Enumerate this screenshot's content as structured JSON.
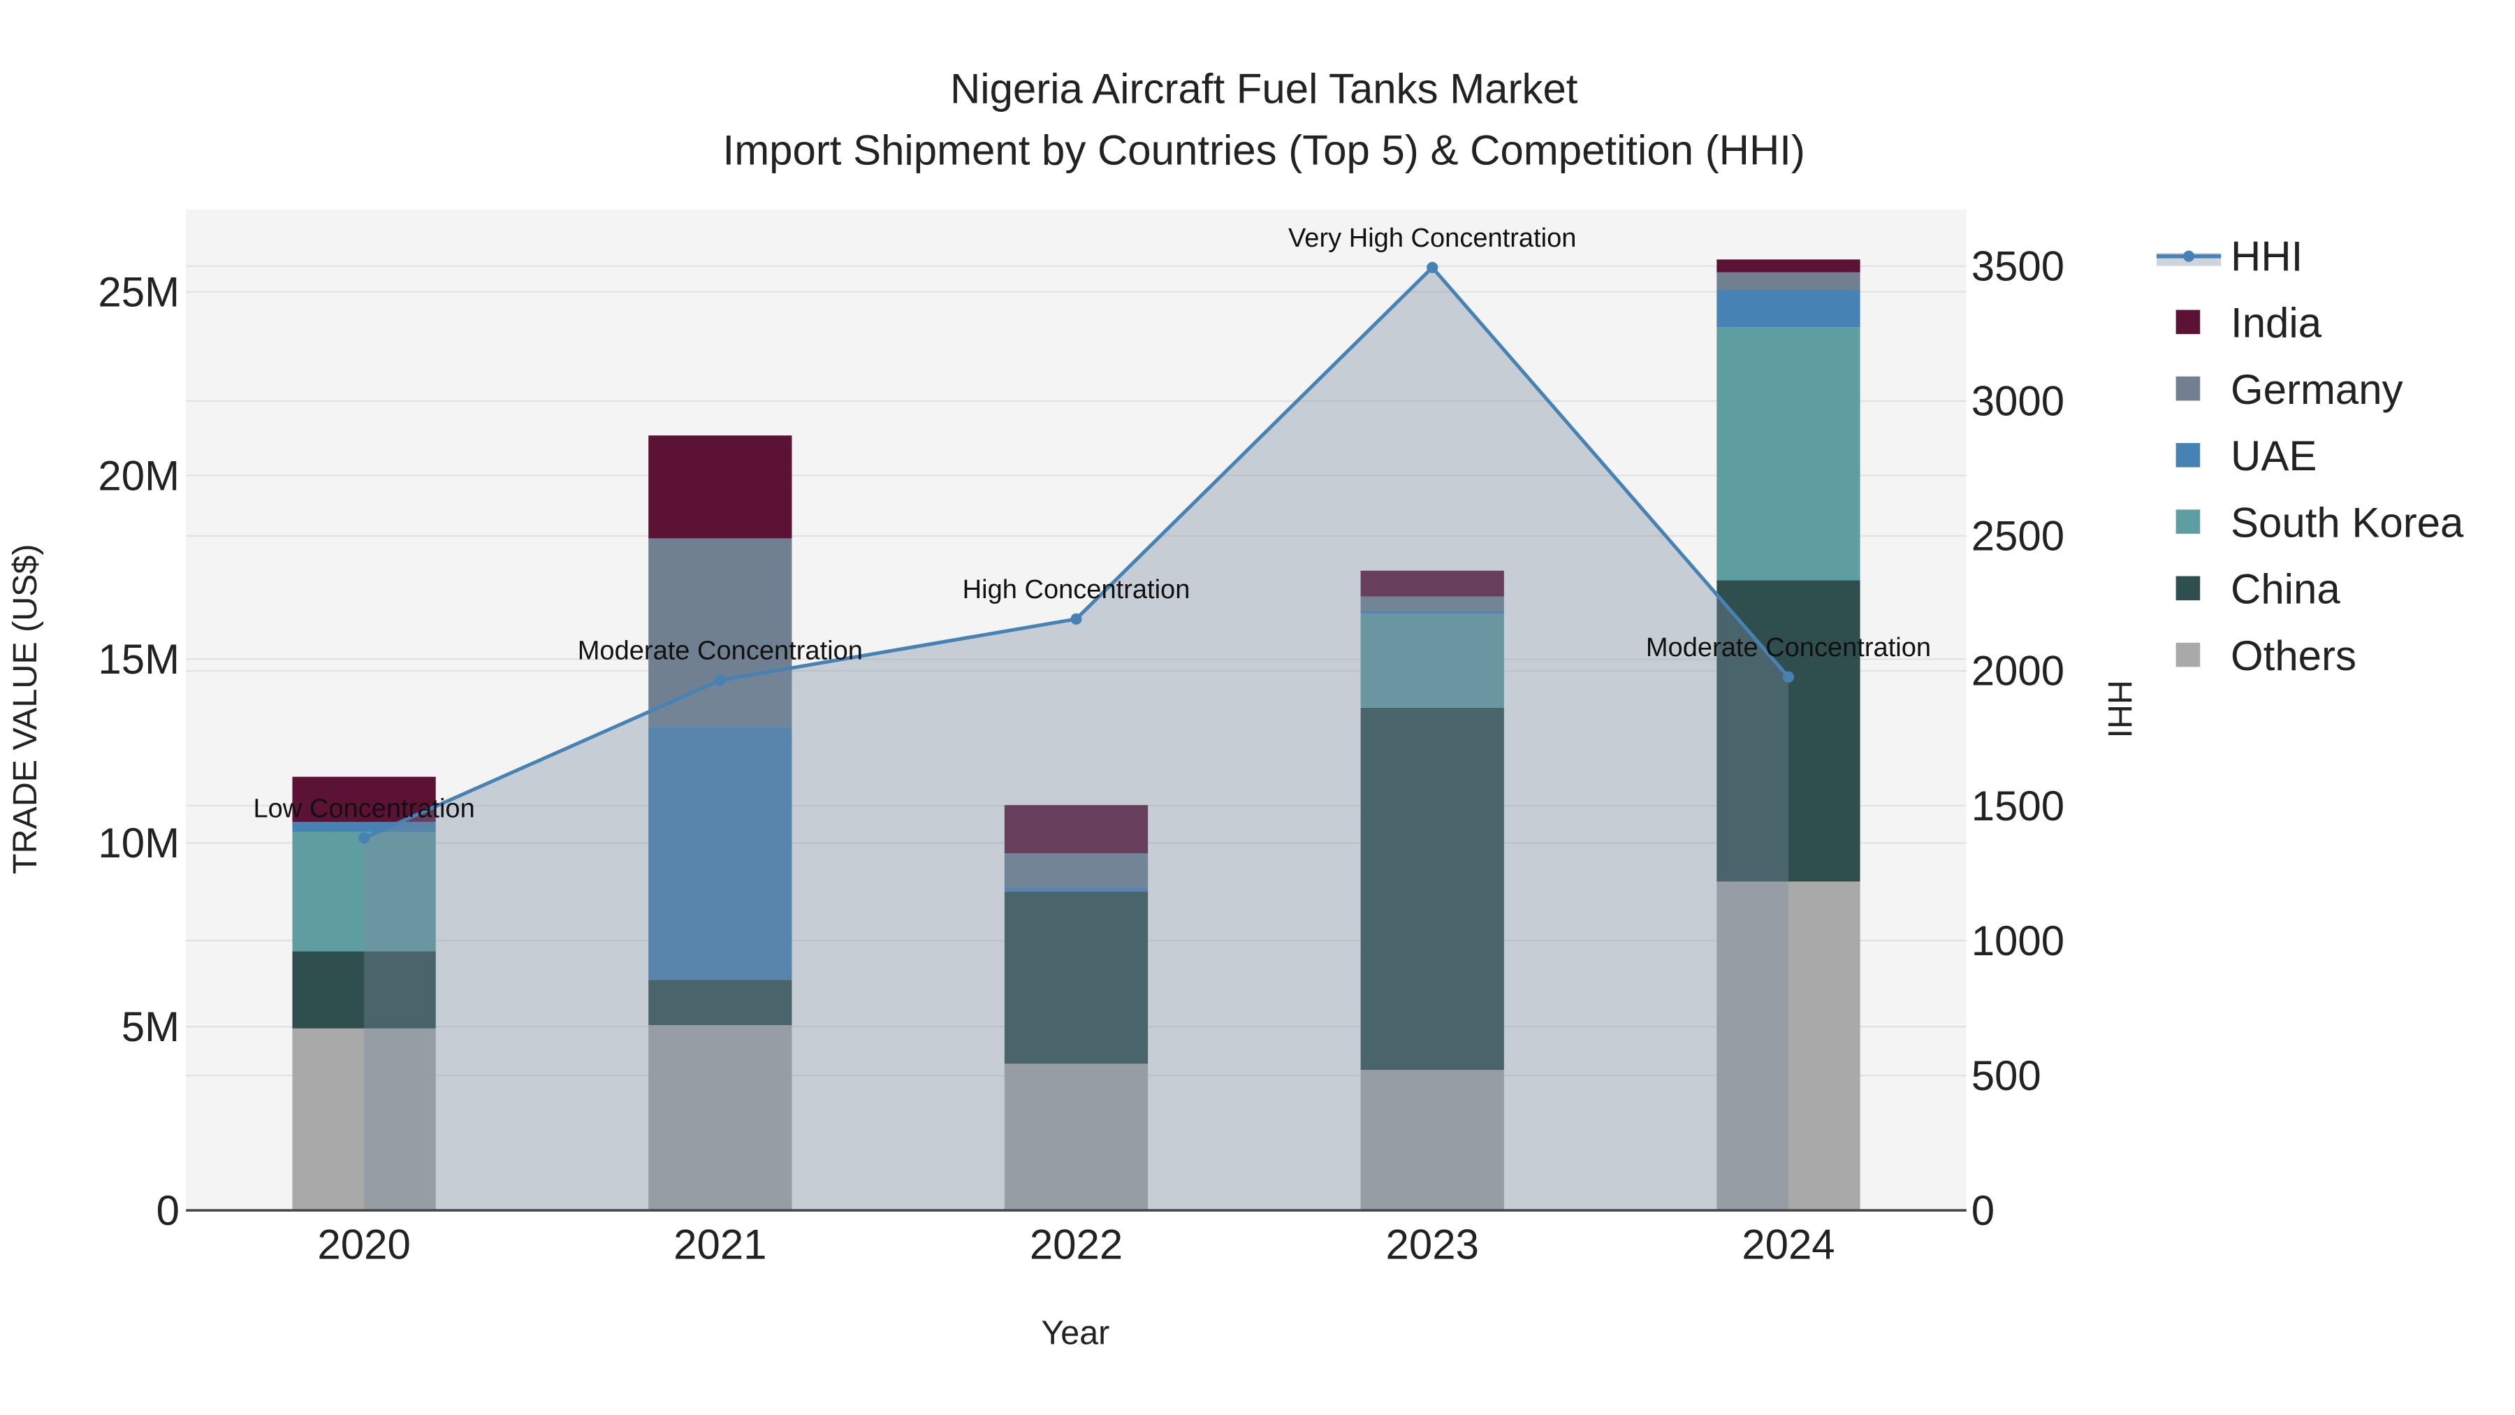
{
  "chart_data": {
    "type": "bar",
    "stacking": "stacked",
    "title": "Nigeria Aircraft Fuel Tanks Market",
    "subtitle": "Import Shipment by Countries (Top 5) & Competition (HHI)",
    "xlabel": "Year",
    "ylabel": "TRADE VALUE (US$)",
    "y2label": "HHI",
    "categories": [
      "2020",
      "2021",
      "2022",
      "2023",
      "2024"
    ],
    "ylim": [
      0,
      27240000
    ],
    "y2lim": [
      0,
      3710
    ],
    "yticks": [
      0,
      5000000,
      10000000,
      15000000,
      20000000,
      25000000
    ],
    "ytick_labels": [
      "0",
      "5M",
      "10M",
      "15M",
      "20M",
      "25M"
    ],
    "y2ticks": [
      0,
      500,
      1000,
      1500,
      2000,
      2500,
      3000,
      3500
    ],
    "y2tick_labels": [
      "0",
      "500",
      "1000",
      "1500",
      "2000",
      "2500",
      "3000",
      "3500"
    ],
    "grid": true,
    "legend_position": "right",
    "series": [
      {
        "name": "Others",
        "color": "#a9a9a9",
        "values": [
          4950000,
          5040000,
          3990000,
          3820000,
          8950000
        ]
      },
      {
        "name": "China",
        "color": "#2f4f4f",
        "values": [
          2100000,
          1230000,
          4690000,
          9860000,
          8200000
        ]
      },
      {
        "name": "South Korea",
        "color": "#5f9ea0",
        "values": [
          3250000,
          0,
          0,
          2550000,
          6890000
        ]
      },
      {
        "name": "UAE",
        "color": "#4682b4",
        "values": [
          270000,
          6890000,
          120000,
          90000,
          1000000
        ]
      },
      {
        "name": "Germany",
        "color": "#708090",
        "values": [
          0,
          5130000,
          920000,
          390000,
          490000
        ]
      },
      {
        "name": "India",
        "color": "#5c1234",
        "values": [
          1230000,
          2800000,
          1310000,
          700000,
          350000
        ]
      }
    ],
    "line": {
      "name": "HHI",
      "color": "#4682b4",
      "values": [
        1380,
        1965,
        2192,
        3495,
        1977
      ],
      "annotations": [
        "Low Concentration",
        "Moderate Concentration",
        "High Concentration",
        "Very High Concentration",
        "Moderate Concentration"
      ]
    },
    "legend_order": [
      "HHI",
      "India",
      "Germany",
      "UAE",
      "South Korea",
      "China",
      "Others"
    ]
  }
}
